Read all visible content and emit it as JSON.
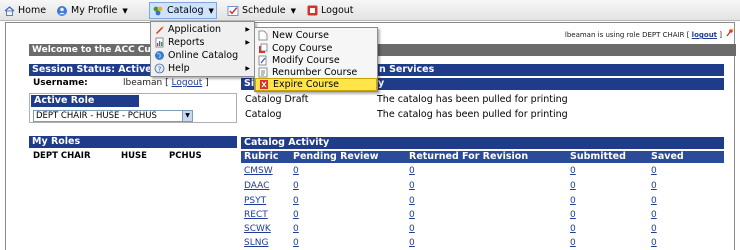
{
  "menubar": {
    "home": "Home",
    "my_profile": "My Profile",
    "catalog": "Catalog",
    "schedule": "Schedule",
    "logout": "Logout"
  },
  "header": {
    "role_note": "lbeaman is using role DEPT CHAIR [",
    "role_note_link": "logout",
    "role_note_end": "]"
  },
  "welcome": "Welcome to the ACC Cu",
  "session": {
    "title": "Session Status: Active",
    "username_label": "Username:",
    "username_value": "lbeaman [",
    "logout_link": "Logout",
    "logout_end": "]"
  },
  "active_role": {
    "title": "Active Role",
    "selected": "DEPT CHAIR - HUSE - PCHUS"
  },
  "my_roles": {
    "title": "My Roles",
    "role": "DEPT CHAIR",
    "dept": "HUSE",
    "code": "PCHUS"
  },
  "services": {
    "title": "n Services",
    "subheader": "Si",
    "subheader_tail": "y",
    "rows": [
      {
        "name": "Catalog Draft",
        "status": "The catalog has been pulled for printing"
      },
      {
        "name": "Catalog",
        "status": "The catalog has been pulled for printing"
      }
    ]
  },
  "catalog_activity": {
    "title": "Catalog Activity",
    "columns": [
      "Rubric",
      "Pending Review",
      "Returned For Revision",
      "Submitted",
      "Saved"
    ],
    "rows": [
      {
        "rubric": "CMSW",
        "pending": "0",
        "returned": "0",
        "submitted": "0",
        "saved": "0"
      },
      {
        "rubric": "DAAC",
        "pending": "0",
        "returned": "0",
        "submitted": "0",
        "saved": "0"
      },
      {
        "rubric": "PSYT",
        "pending": "0",
        "returned": "0",
        "submitted": "0",
        "saved": "0"
      },
      {
        "rubric": "RECT",
        "pending": "0",
        "returned": "0",
        "submitted": "0",
        "saved": "0"
      },
      {
        "rubric": "SCWK",
        "pending": "0",
        "returned": "0",
        "submitted": "0",
        "saved": "0"
      },
      {
        "rubric": "SLNG",
        "pending": "0",
        "returned": "0",
        "submitted": "0",
        "saved": "0"
      }
    ]
  },
  "catalog_menu": {
    "items": [
      "Application",
      "Reports",
      "Online Catalog",
      "Help"
    ]
  },
  "application_submenu": {
    "items": [
      "New Course",
      "Copy Course",
      "Modify Course",
      "Renumber Course",
      "Expire Course"
    ],
    "highlighted": "Expire Course"
  },
  "colors": {
    "navy": "#1f3c8a",
    "grey_bar": "#6b6b6b",
    "highlight": "#ffe54a",
    "link": "#1f3c99"
  }
}
